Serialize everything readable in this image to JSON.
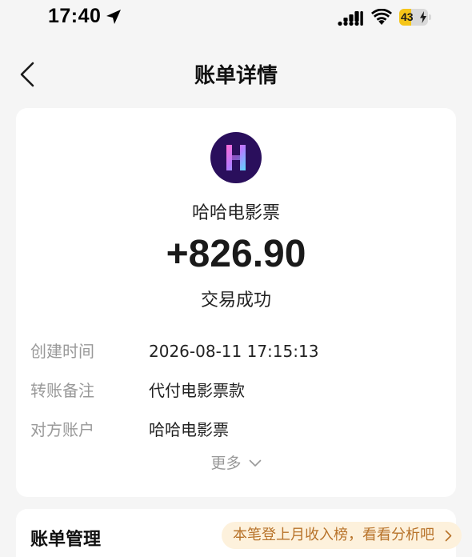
{
  "status_bar": {
    "time": "17:40",
    "battery_level": 43,
    "battery_label": "43"
  },
  "nav": {
    "title": "账单详情"
  },
  "bill": {
    "merchant_name": "哈哈电影票",
    "amount": "+826.90",
    "status": "交易成功",
    "details": [
      {
        "label": "创建时间",
        "value": "2026-08-11 17:15:13"
      },
      {
        "label": "转账备注",
        "value": "代付电影票款"
      },
      {
        "label": "对方账户",
        "value": "哈哈电影票"
      }
    ],
    "more_label": "更多"
  },
  "management": {
    "title": "账单管理",
    "promo_text": "本笔登上月收入榜，看看分析吧"
  },
  "colors": {
    "page_bg": "#f5f5f5",
    "card_bg": "#ffffff",
    "battery_accent": "#f5c518",
    "logo_bg": "#2a0f5c",
    "promo_bg": "#fdf1dc",
    "promo_text": "#b8732a",
    "label_gray": "#999999"
  }
}
